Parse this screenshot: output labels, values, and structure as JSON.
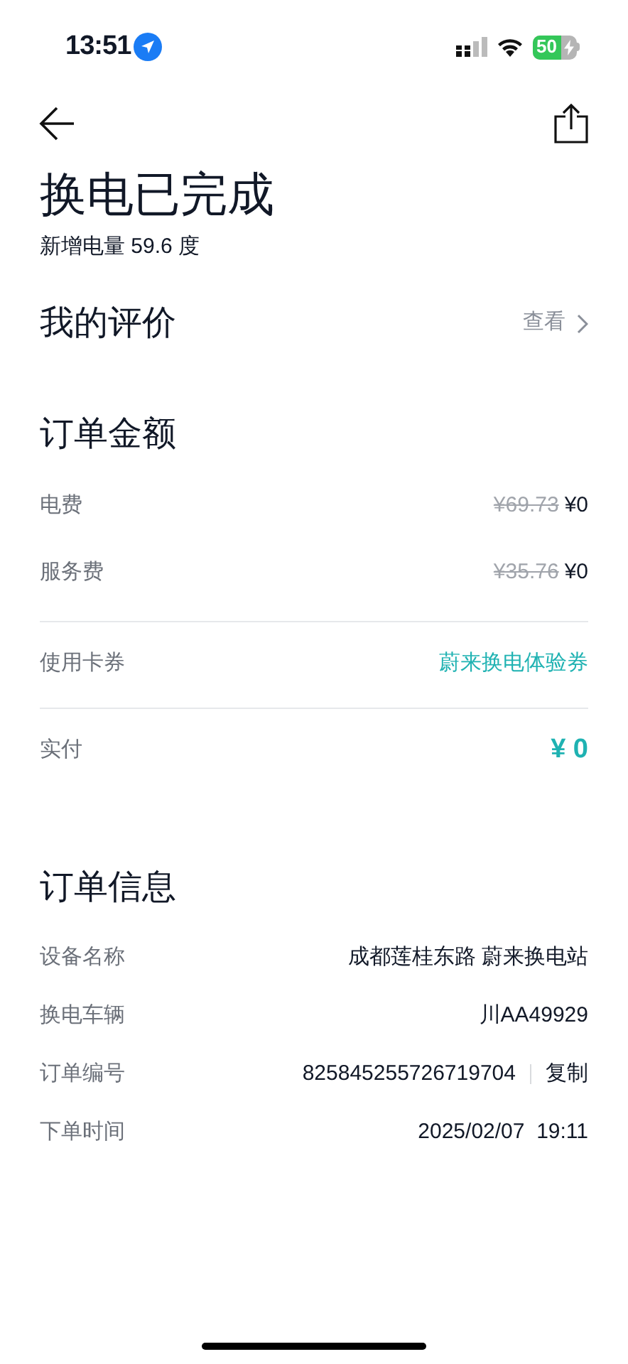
{
  "status_bar": {
    "time": "13:51",
    "battery": "50"
  },
  "header": {
    "title": "换电已完成",
    "subtitle": "新增电量 59.6 度"
  },
  "review": {
    "title": "我的评价",
    "action": "查看"
  },
  "order_amount": {
    "title": "订单金额",
    "fees": [
      {
        "label": "电费",
        "original": "¥69.73",
        "price": "¥0"
      },
      {
        "label": "服务费",
        "original": "¥35.76",
        "price": "¥0"
      }
    ],
    "coupon": {
      "label": "使用卡券",
      "value": "蔚来换电体验券"
    },
    "paid": {
      "label": "实付",
      "value": "¥ 0"
    }
  },
  "order_info": {
    "title": "订单信息",
    "rows": [
      {
        "label": "设备名称",
        "value": "成都莲桂东路 蔚来换电站"
      },
      {
        "label": "换电车辆",
        "value": "川AA49929"
      },
      {
        "label": "订单编号",
        "value": "825845255726719704",
        "action": "复制"
      },
      {
        "label": "下单时间",
        "value": "2025/02/07  19:11"
      }
    ]
  }
}
